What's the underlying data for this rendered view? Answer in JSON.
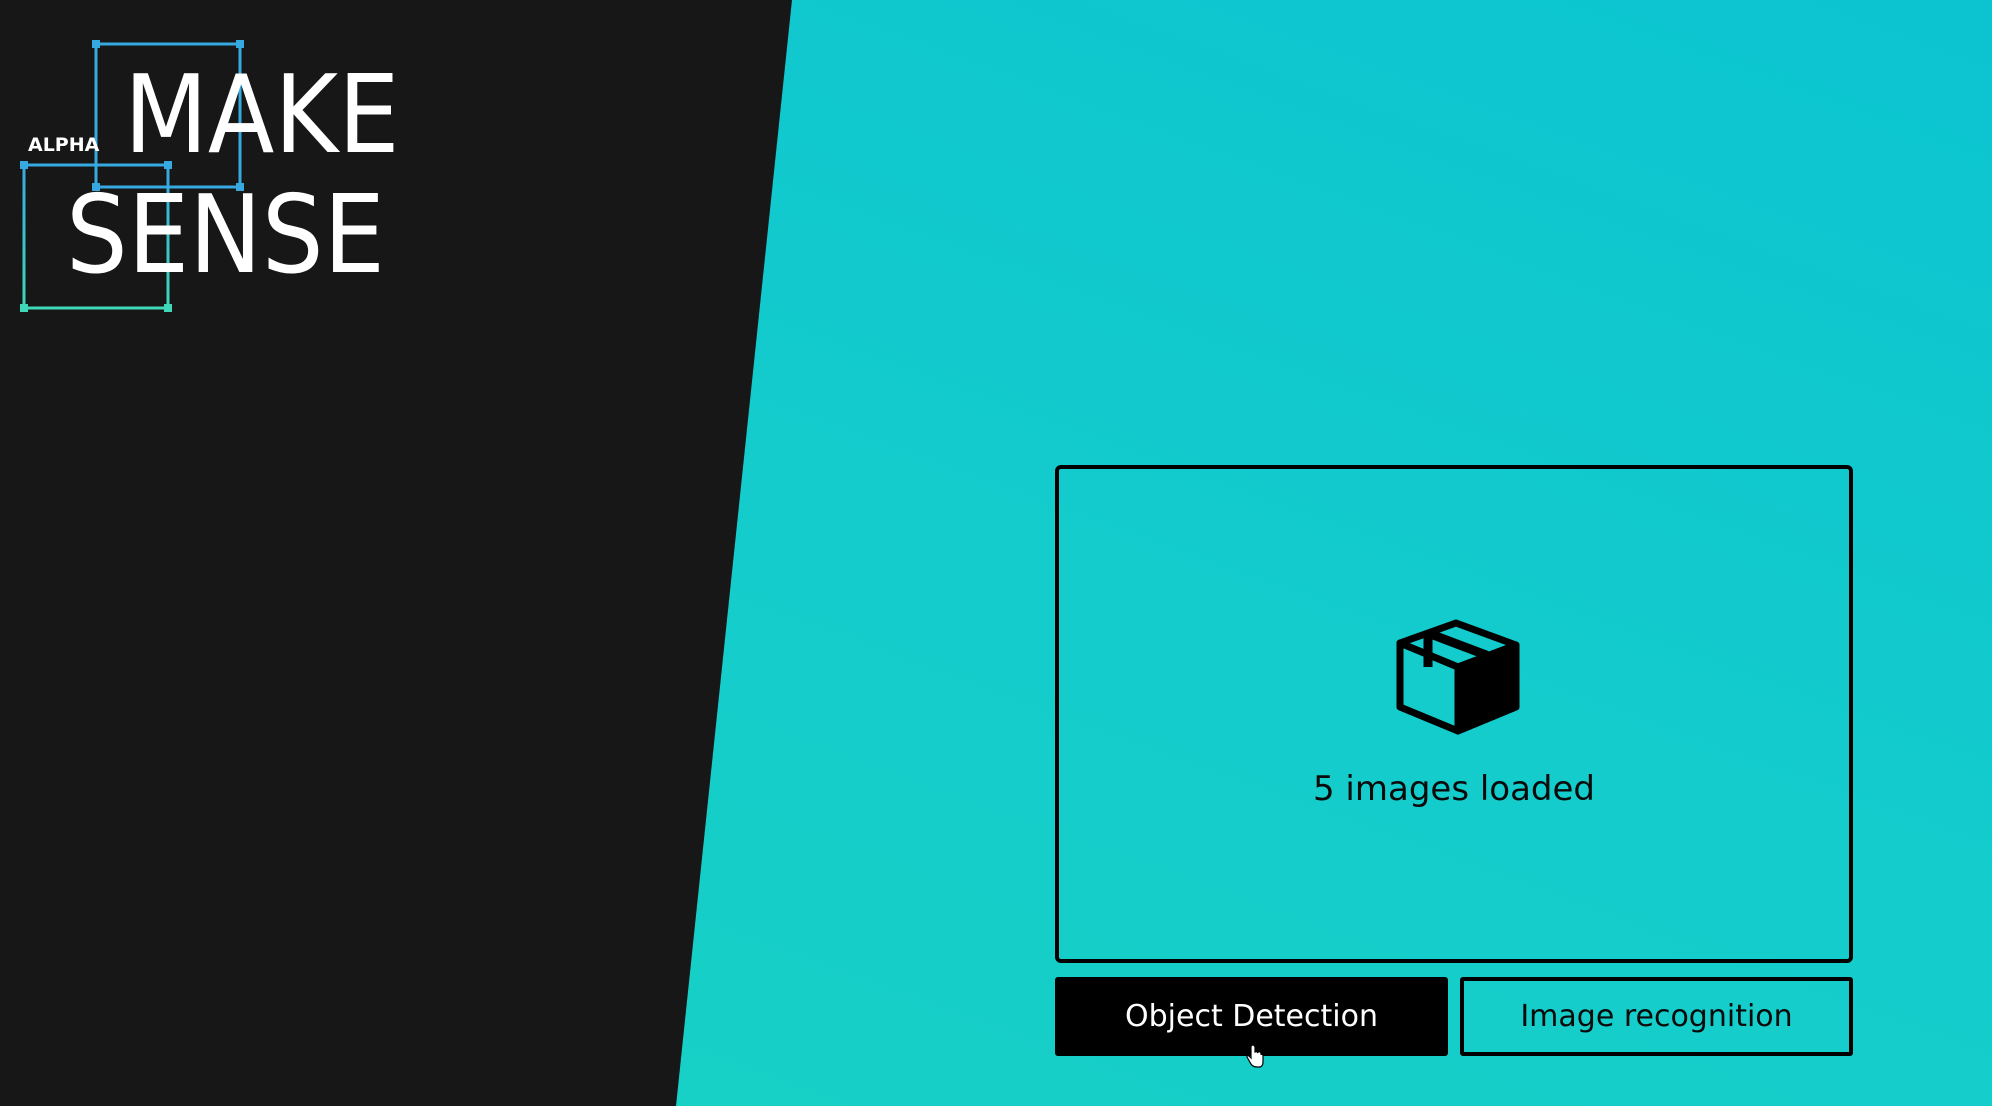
{
  "logo": {
    "badge": "ALPHA",
    "line1": "MAKE",
    "line2": "SENSE"
  },
  "drop_zone": {
    "icon": "box-icon",
    "status_text": "5 images loaded"
  },
  "buttons": {
    "object_detection": "Object Detection",
    "image_recognition": "Image recognition"
  },
  "colors": {
    "dark_panel": "#171718",
    "accent_background": "#14cccc",
    "logo_frame_blue": "#36a9e1",
    "logo_frame_green": "#3fd8b9"
  }
}
